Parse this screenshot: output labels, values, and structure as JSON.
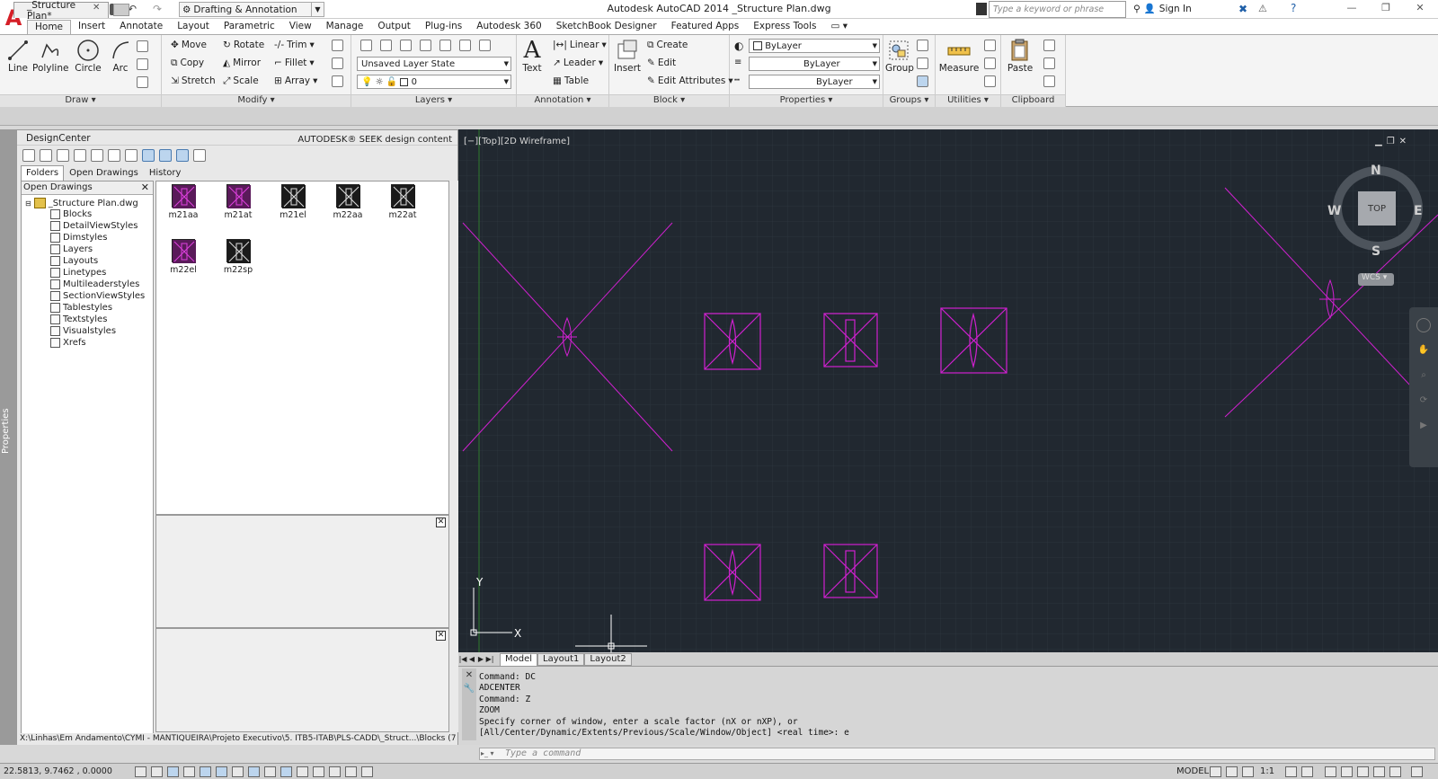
{
  "app": {
    "title": "Autodesk AutoCAD 2014    _Structure Plan.dwg",
    "logo": "A",
    "workspace": "Drafting & Annotation",
    "search_placeholder": "Type a keyword or phrase",
    "sign_in": "Sign In"
  },
  "ribbon_tabs": [
    "Home",
    "Insert",
    "Annotate",
    "Layout",
    "Parametric",
    "View",
    "Manage",
    "Output",
    "Plug-ins",
    "Autodesk 360",
    "SketchBook Designer",
    "Featured Apps",
    "Express Tools"
  ],
  "ribbon": {
    "draw": {
      "title": "Draw",
      "line": "Line",
      "polyline": "Polyline",
      "circle": "Circle",
      "arc": "Arc"
    },
    "modify": {
      "title": "Modify",
      "move": "Move",
      "rotate": "Rotate",
      "trim": "Trim",
      "copy": "Copy",
      "mirror": "Mirror",
      "fillet": "Fillet",
      "stretch": "Stretch",
      "scale": "Scale",
      "array": "Array"
    },
    "layers": {
      "title": "Layers",
      "layer_state": "Unsaved Layer State",
      "current_layer": "0"
    },
    "annotation": {
      "title": "Annotation",
      "text": "Text",
      "linear": "Linear",
      "leader": "Leader",
      "table": "Table"
    },
    "block": {
      "title": "Block",
      "insert": "Insert",
      "create": "Create",
      "edit": "Edit",
      "edit_attributes": "Edit Attributes"
    },
    "properties": {
      "title": "Properties",
      "color": "ByLayer",
      "linetype": "ByLayer",
      "lineweight": "ByLayer"
    },
    "groups": {
      "title": "Groups",
      "group": "Group"
    },
    "utilities": {
      "title": "Utilities",
      "measure": "Measure"
    },
    "clipboard": {
      "title": "Clipboard",
      "paste": "Paste"
    }
  },
  "document_tab": "_Structure Plan*",
  "properties_label": "Properties",
  "design_center": {
    "title": "DesignCenter",
    "seek": "AUTODESK® SEEK design content",
    "tabs": [
      "Folders",
      "Open Drawings",
      "History"
    ],
    "tree_header": "Open Drawings",
    "tree_root": "_Structure Plan.dwg",
    "tree_items": [
      "Blocks",
      "DetailViewStyles",
      "Dimstyles",
      "Layers",
      "Layouts",
      "Linetypes",
      "Multileaderstyles",
      "SectionViewStyles",
      "Tablestyles",
      "Textstyles",
      "Visualstyles",
      "Xrefs"
    ],
    "blocks": [
      "m21aa",
      "m21at",
      "m21el",
      "m22aa",
      "m22at",
      "m22el",
      "m22sp"
    ],
    "status_path": "X:\\Linhas\\Em Andamento\\CYMI - MANTIQUEIRA\\Projeto Executivo\\5. ITB5-ITAB\\PLS-CADD\\_Struct...\\Blocks (7 Item(s))"
  },
  "viewport": {
    "label": "[−][Top][2D Wireframe]",
    "viewcube": {
      "north": "N",
      "south": "S",
      "east": "E",
      "west": "W",
      "face": "TOP"
    },
    "wcs": "WCS ▾",
    "ucs_x": "X",
    "ucs_y": "Y"
  },
  "layout_tabs": [
    "Model",
    "Layout1",
    "Layout2"
  ],
  "command_history": [
    "Command: DC",
    "ADCENTER",
    "Command: Z",
    "ZOOM",
    "Specify corner of window, enter a scale factor (nX or nXP), or",
    "[All/Center/Dynamic/Extents/Previous/Scale/Window/Object] <real time>: e"
  ],
  "command_placeholder": "Type a command",
  "status": {
    "coords": "22.5813, 9.7462 , 0.0000",
    "model": "MODEL",
    "scale": "1:1"
  },
  "colors": {
    "accent": "#d51f27",
    "canvas": "#212830",
    "entity": "#d020d0"
  }
}
